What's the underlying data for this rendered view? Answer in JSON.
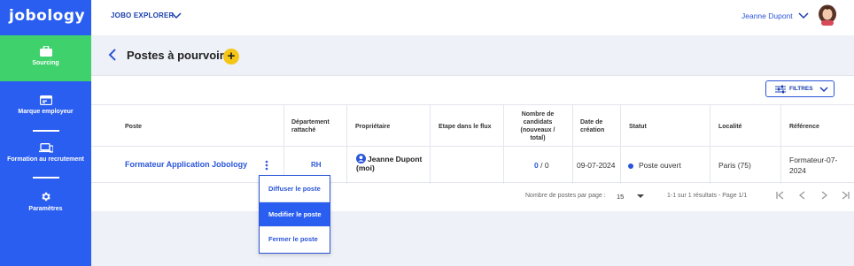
{
  "brand": {
    "logo_text": "jobology"
  },
  "sidebar": {
    "items": [
      {
        "label": "Sourcing",
        "icon": "briefcase-icon",
        "active": true
      },
      {
        "label": "Marque employeur",
        "icon": "id-card-icon",
        "active": false
      },
      {
        "label": "Formation au recrutement",
        "icon": "laptop-icon",
        "active": false
      },
      {
        "label": "Paramètres",
        "icon": "gear-icon",
        "active": false
      }
    ]
  },
  "topbar": {
    "explorer_label": "JOBO EXPLORER",
    "user_name": "Jeanne Dupont"
  },
  "page": {
    "title": "Postes à pourvoir",
    "add_label": "+"
  },
  "filters": {
    "label": "FILTRES"
  },
  "table": {
    "headers": {
      "poste": "Poste",
      "departement": "Département rattaché",
      "proprietaire": "Propriétaire",
      "etape": "Etape dans le flux",
      "candidats": "Nombre de candidats (nouveaux / total)",
      "date": "Date de création",
      "statut": "Statut",
      "localite": "Localité",
      "reference": "Référence"
    },
    "rows": [
      {
        "poste": "Formateur Application Jobology",
        "departement": "RH",
        "proprietaire": "Jeanne Dupont",
        "proprietaire_suffix": "(moi)",
        "etape": "",
        "candidats_new": "0",
        "candidats_total": " / 0",
        "date": "09-07-2024",
        "statut": "Poste ouvert",
        "localite": "Paris (75)",
        "reference": "Formateur-07-2024"
      }
    ]
  },
  "pagination": {
    "per_page_label": "Nombre de postes par page :",
    "per_page_value": "15",
    "info": "1-1 sur 1 résultats - Page 1/1"
  },
  "row_menu": {
    "items": [
      {
        "label": "Diffuser le poste",
        "active": false
      },
      {
        "label": "Modifier le poste",
        "active": true
      },
      {
        "label": "Fermer le poste",
        "active": false
      }
    ]
  },
  "colors": {
    "sidebar": "#2a5ef0",
    "active_nav": "#3fd16c",
    "accent": "#2a55d8",
    "add_button": "#f5c518"
  }
}
